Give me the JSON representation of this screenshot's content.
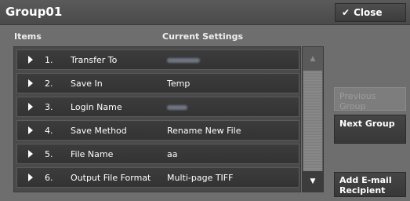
{
  "window": {
    "title": "Group01",
    "close_label": "Close"
  },
  "columns": {
    "items": "Items",
    "current_settings": "Current Settings"
  },
  "rows": [
    {
      "num": "1.",
      "label": "Transfer To",
      "value": "",
      "redacted": true
    },
    {
      "num": "2.",
      "label": "Save In",
      "value": "Temp",
      "redacted": false
    },
    {
      "num": "3.",
      "label": "Login Name",
      "value": "",
      "redacted": true
    },
    {
      "num": "4.",
      "label": "Save Method",
      "value": "Rename New File",
      "redacted": false
    },
    {
      "num": "5.",
      "label": "File Name",
      "value": "aa",
      "redacted": false
    },
    {
      "num": "6.",
      "label": "Output File Format",
      "value": "Multi-page TIFF",
      "redacted": false
    }
  ],
  "side_buttons": {
    "previous_group": "Previous Group",
    "next_group": "Next Group",
    "add_email_recipient": "Add E-mail Recipient"
  },
  "icons": {
    "close": "checkmark-icon",
    "row": "triangle-right-icon",
    "scroll_up": "triangle-up-icon",
    "scroll_down": "triangle-down-icon"
  }
}
